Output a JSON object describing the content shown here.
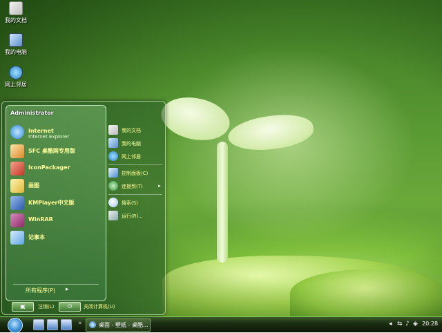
{
  "desktop": {
    "icons": [
      {
        "label": "我的文档",
        "icon": "documents-folder-icon"
      },
      {
        "label": "我的电脑",
        "icon": "my-computer-icon"
      },
      {
        "label": "网上邻居",
        "icon": "network-icon"
      }
    ]
  },
  "start_menu": {
    "user": "Administrator",
    "programs": [
      {
        "name": "Internet",
        "sub": "Internet Explorer",
        "icon": "internet-explorer-icon",
        "color": "#2f86d6"
      },
      {
        "name": "SFC 桌酷网专用版",
        "sub": "",
        "icon": "sfc-app-icon",
        "color": "#d98a2b"
      },
      {
        "name": "IconPackager",
        "sub": "",
        "icon": "iconpackager-icon",
        "color": "#c0392b"
      },
      {
        "name": "画图",
        "sub": "",
        "icon": "paint-icon",
        "color": "#e0b93a"
      },
      {
        "name": "KMPlayer中文版",
        "sub": "",
        "icon": "kmplayer-icon",
        "color": "#2b5aa8"
      },
      {
        "name": "WinRAR",
        "sub": "",
        "icon": "winrar-icon",
        "color": "#8e2a6a"
      },
      {
        "name": "记事本",
        "sub": "",
        "icon": "notepad-icon",
        "color": "#5fa6e0"
      }
    ],
    "all_programs": "所有程序(P)",
    "right_items": [
      {
        "label": "我的文档",
        "icon": "documents-folder-icon"
      },
      {
        "label": "我的电脑",
        "icon": "my-computer-icon"
      },
      {
        "label": "网上邻居",
        "icon": "network-icon"
      },
      {
        "label": "控制面板(C)",
        "icon": "control-panel-icon"
      },
      {
        "label": "连接到(T)",
        "icon": "connect-to-icon"
      },
      {
        "label": "搜索(S)",
        "icon": "search-icon"
      },
      {
        "label": "运行(R)...",
        "icon": "run-icon"
      }
    ],
    "logoff_label": "注销(L)",
    "shutdown_label": "关闭计算机(U)"
  },
  "taskbar": {
    "task_label": "桌面 - 壁纸 - 桌酷...",
    "clock": "20:28"
  },
  "colors": {
    "menu_text": "#ffff9a",
    "taskbar": "#1b2e12",
    "accent": "#7fc95a"
  }
}
